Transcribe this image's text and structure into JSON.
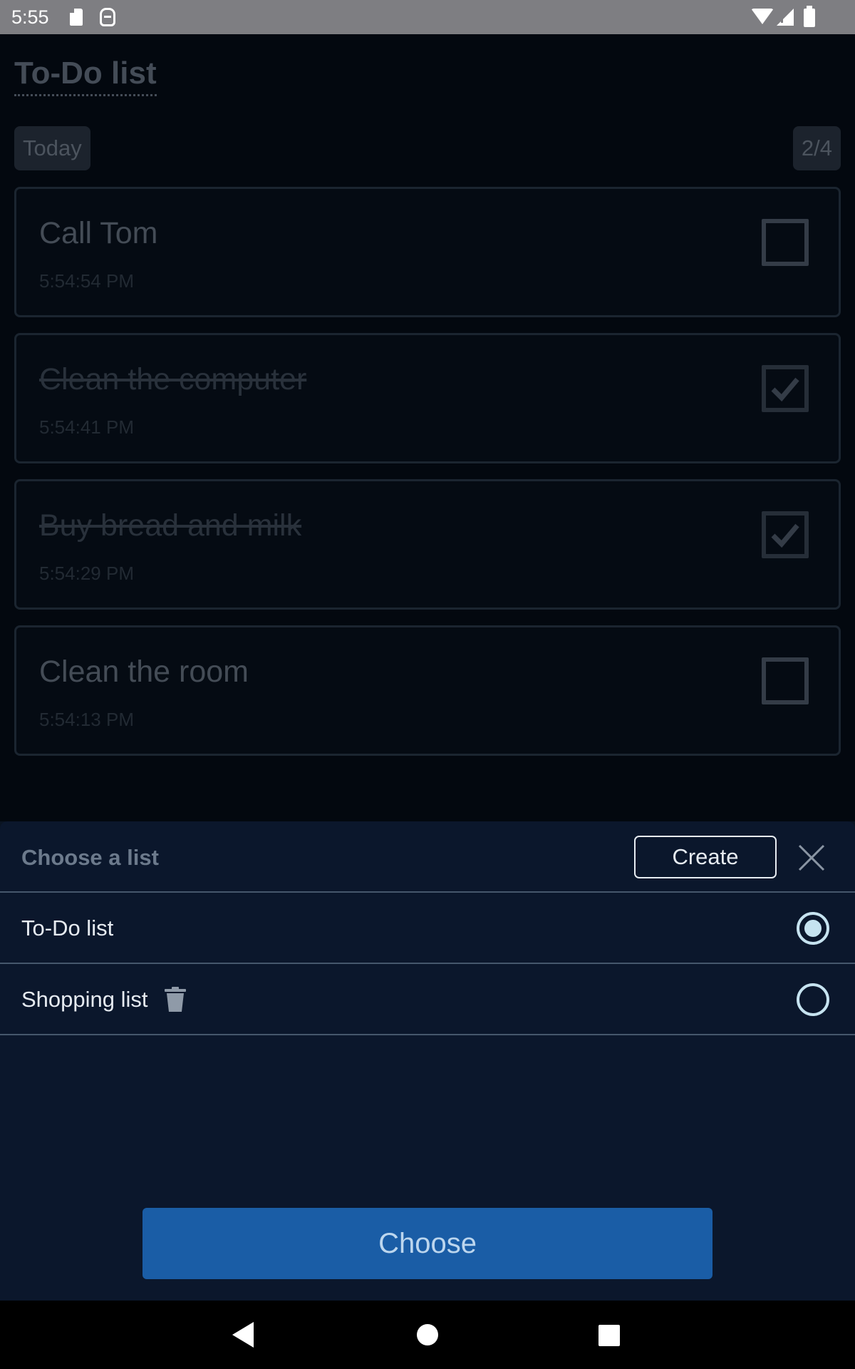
{
  "status_bar": {
    "time": "5:55",
    "icons": [
      "sd-card-icon",
      "robot-icon",
      "wifi-icon",
      "signal-icon",
      "battery-icon"
    ]
  },
  "app": {
    "title": "To-Do list",
    "filter_chip": "Today",
    "progress": "2/4",
    "tasks": [
      {
        "title": "Call Tom",
        "time": "5:54:54 PM",
        "done": false
      },
      {
        "title": "Clean the computer",
        "time": "5:54:41 PM",
        "done": true
      },
      {
        "title": "Buy bread and milk",
        "time": "5:54:29 PM",
        "done": true
      },
      {
        "title": "Clean the room",
        "time": "5:54:13 PM",
        "done": false
      }
    ]
  },
  "sheet": {
    "title": "Choose a list",
    "create_label": "Create",
    "options": [
      {
        "label": "To-Do list",
        "selected": true,
        "deletable": false
      },
      {
        "label": "Shopping list",
        "selected": false,
        "deletable": true
      }
    ],
    "choose_label": "Choose"
  },
  "colors": {
    "accent": "#1a5da6",
    "sheet_bg": "#0b172c",
    "radio": "#c6e3f0"
  }
}
